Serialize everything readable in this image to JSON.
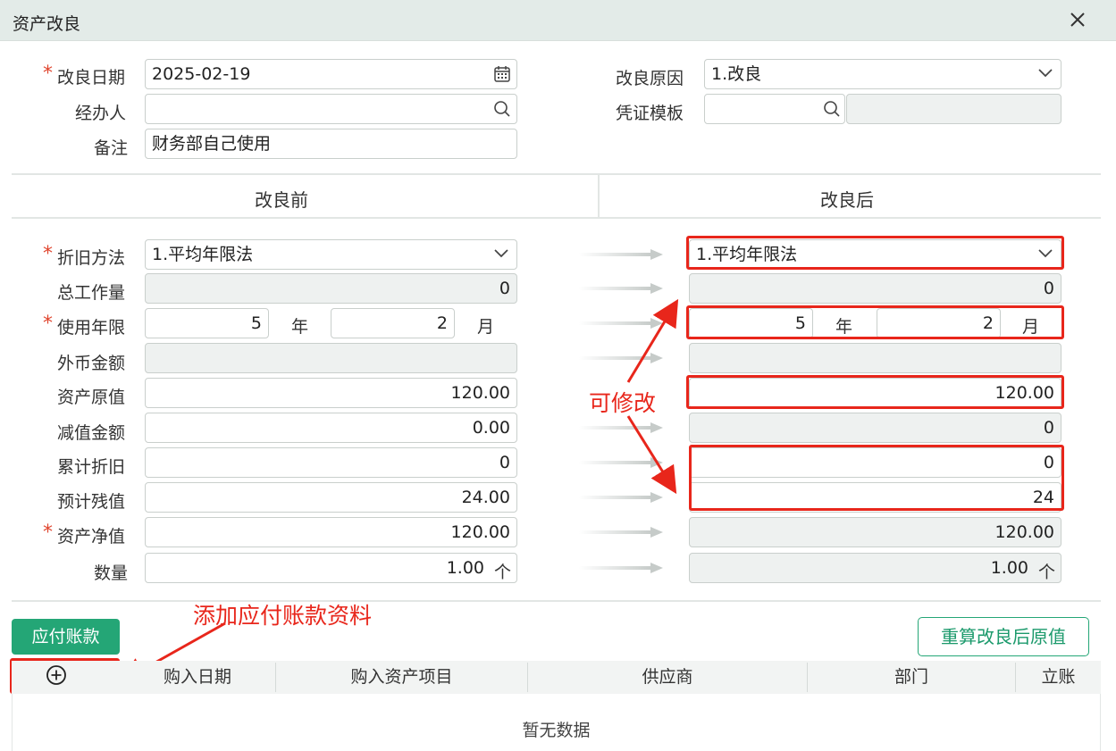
{
  "window": {
    "title": "资产改良"
  },
  "top_form": {
    "date_label": "改良日期",
    "date_value": "2025-02-19",
    "handler_label": "经办人",
    "handler_value": "",
    "note_label": "备注",
    "note_value": "财务部自己使用",
    "reason_label": "改良原因",
    "reason_value": "1.改良",
    "voucher_label": "凭证模板",
    "voucher_value": "",
    "voucher_extra": ""
  },
  "columns": {
    "before": "改良前",
    "after": "改良后"
  },
  "fields": {
    "method_label": "折旧方法",
    "total_work_label": "总工作量",
    "years_label": "使用年限",
    "foreign_label": "外币金额",
    "original_label": "资产原值",
    "impair_label": "减值金额",
    "accum_label": "累计折旧",
    "residual_label": "预计残值",
    "net_label": "资产净值",
    "qty_label": "数量"
  },
  "before": {
    "method": "1.平均年限法",
    "total_work": "0",
    "years": "5",
    "months": "2",
    "foreign": "",
    "original": "120.00",
    "impair": "0.00",
    "accum": "0",
    "residual": "24.00",
    "net": "120.00",
    "qty": "1.00"
  },
  "after": {
    "method": "1.平均年限法",
    "total_work": "0",
    "years": "5",
    "months": "2",
    "foreign": "",
    "original": "120.00",
    "impair": "0",
    "accum": "0",
    "residual": "24",
    "net": "120.00",
    "qty": "1.00"
  },
  "units": {
    "year": "年",
    "month": "月",
    "piece": "个"
  },
  "annotations": {
    "editable": "可修改",
    "add_payable": "添加应付账款资料"
  },
  "buttons": {
    "payable": "应付账款",
    "recalc": "重算改良后原值"
  },
  "table": {
    "headers": [
      "购入日期",
      "购入资产项目",
      "供应商",
      "部门",
      "立账"
    ],
    "empty_text": "暂无数据"
  },
  "colors": {
    "accent": "#24a676",
    "annotation": "#e8261b",
    "required": "#e0452e"
  },
  "icons": [
    "close-icon",
    "calendar-icon",
    "search-icon",
    "chevron-down-icon",
    "arrow-right-icon",
    "add-circle-icon"
  ]
}
